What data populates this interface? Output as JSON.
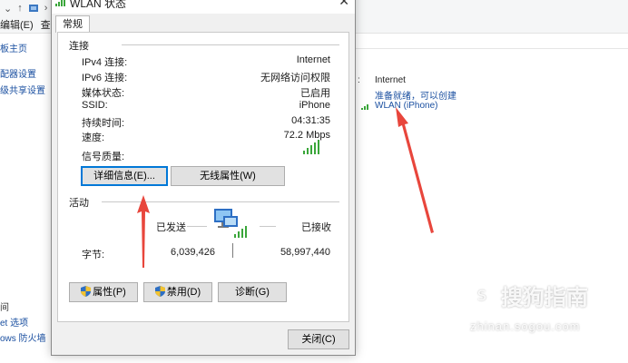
{
  "background": {
    "nav_arrow": "↑",
    "menu": [
      "编辑(E)",
      "查看("
    ],
    "sidebar": [
      "板主页",
      "配器设置",
      "级共享设置"
    ],
    "sidebar_bottom": [
      "间",
      "et 选项",
      "ows 防火墙"
    ],
    "right": {
      "net_type": "Internet",
      "status": "准备就绪，可以创建",
      "connection": "WLAN (iPhone)"
    }
  },
  "dialog": {
    "title": "WLAN 状态",
    "close": "✕",
    "tab": "常规",
    "connection": {
      "header": "连接",
      "rows": [
        {
          "label": "IPv4 连接:",
          "value": "Internet"
        },
        {
          "label": "IPv6 连接:",
          "value": "无网络访问权限"
        },
        {
          "label": "媒体状态:",
          "value": "已启用"
        },
        {
          "label": "SSID:",
          "value": "iPhone"
        },
        {
          "label": "持续时间:",
          "value": "04:31:35"
        },
        {
          "label": "速度:",
          "value": "72.2 Mbps"
        }
      ],
      "signal_label": "信号质量:",
      "signal_bars": 5,
      "details_button": "详细信息(E)...",
      "wireless_button": "无线属性(W)"
    },
    "activity": {
      "header": "活动",
      "sent_label": "已发送",
      "received_label": "已接收",
      "bytes_label": "字节:",
      "bytes_sent": "6,039,426",
      "bytes_received": "58,997,440",
      "properties_button": "属性(P)",
      "disable_button": "禁用(D)",
      "diagnose_button": "诊断(G)"
    },
    "close_button": "关闭(C)"
  },
  "watermark": {
    "brand": "搜狗指南",
    "url": "zhinan.sogou.com"
  },
  "colors": {
    "arrow": "#e8463c",
    "link": "#1a4fa0",
    "signal": "#3aa63a"
  }
}
